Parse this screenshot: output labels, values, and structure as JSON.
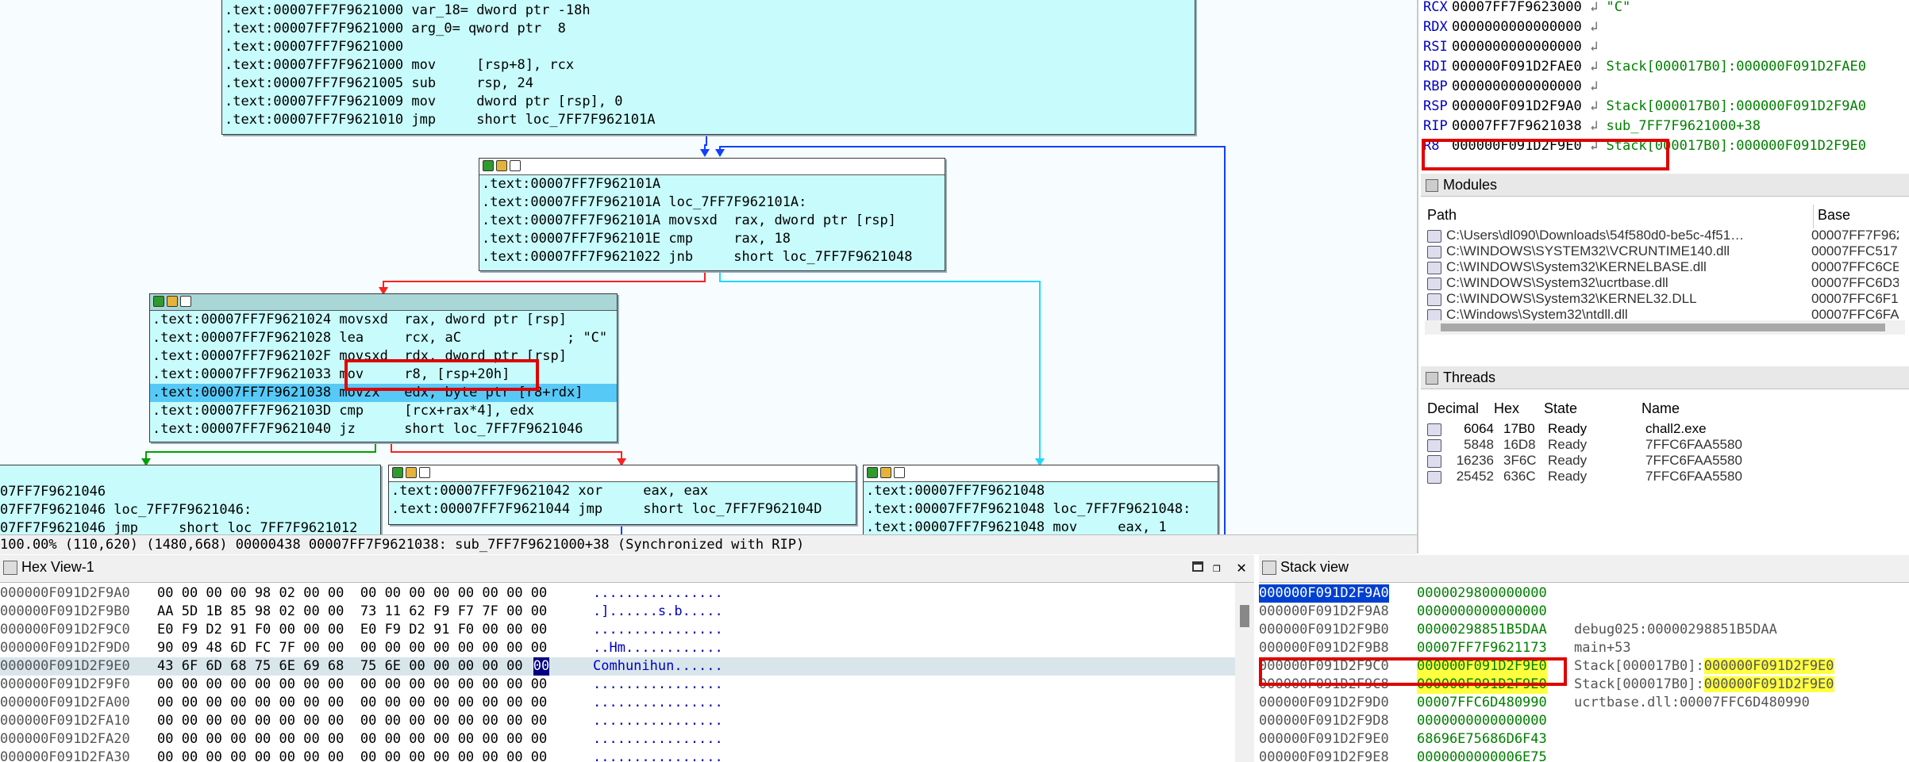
{
  "graph": {
    "top_block": [
      ".text:00007FF7F9621000 var_18= dword ptr -18h",
      ".text:00007FF7F9621000 arg_0= qword ptr  8",
      ".text:00007FF7F9621000",
      ".text:00007FF7F9621000 mov     [rsp+8], rcx",
      ".text:00007FF7F9621005 sub     rsp, 24",
      ".text:00007FF7F9621009 mov     dword ptr [rsp], 0",
      ".text:00007FF7F9621010 jmp     short loc_7FF7F962101A"
    ],
    "loop_block": [
      ".text:00007FF7F962101A",
      ".text:00007FF7F962101A loc_7FF7F962101A:",
      ".text:00007FF7F962101A movsxd  rax, dword ptr [rsp]",
      ".text:00007FF7F962101E cmp     rax, 18",
      ".text:00007FF7F9621022 jnb     short loc_7FF7F9621048"
    ],
    "body_block": [
      ".text:00007FF7F9621024 movsxd  rax, dword ptr [rsp]",
      ".text:00007FF7F9621028 lea     rcx, aC             ; \"C\"",
      ".text:00007FF7F962102F movsxd  rdx, dword ptr [rsp]",
      ".text:00007FF7F9621033 mov     r8, [rsp+20h]",
      ".text:00007FF7F9621038 movzx   edx, byte ptr [r8+rdx]",
      ".text:00007FF7F962103D cmp     [rcx+rax*4], edx",
      ".text:00007FF7F9621040 jz      short loc_7FF7F9621046"
    ],
    "left_block": [
      "07FF7F9621046",
      "07FF7F9621046 loc_7FF7F9621046:",
      "07FF7F9621046 jmp     short loc_7FF7F9621012"
    ],
    "mid_block": [
      ".text:00007FF7F9621042 xor     eax, eax",
      ".text:00007FF7F9621044 jmp     short loc_7FF7F962104D"
    ],
    "right_block": [
      ".text:00007FF7F9621048",
      ".text:00007FF7F9621048 loc_7FF7F9621048:",
      ".text:00007FF7F9621048 mov     eax, 1"
    ]
  },
  "status_bar": "100.00% (110,620) (1480,668) 00000438 00007FF7F9621038: sub_7FF7F9621000+38 (Synchronized with RIP)",
  "registers": [
    {
      "name": "RCX",
      "value": "00007FF7F9623000",
      "comment": "\"C\""
    },
    {
      "name": "RDX",
      "value": "0000000000000000",
      "comment": ""
    },
    {
      "name": "RSI",
      "value": "0000000000000000",
      "comment": ""
    },
    {
      "name": "RDI",
      "value": "000000F091D2FAE0",
      "comment": "Stack[000017B0]:000000F091D2FAE0"
    },
    {
      "name": "RBP",
      "value": "0000000000000000",
      "comment": ""
    },
    {
      "name": "RSP",
      "value": "000000F091D2F9A0",
      "comment": "Stack[000017B0]:000000F091D2F9A0"
    },
    {
      "name": "RIP",
      "value": "00007FF7F9621038",
      "comment": "sub_7FF7F9621000+38"
    },
    {
      "name": "R8",
      "value": "000000F091D2F9E0",
      "comment": "Stack[000017B0]:000000F091D2F9E0"
    }
  ],
  "modules": {
    "title": "Modules",
    "columns": [
      "Path",
      "Base"
    ],
    "rows": [
      {
        "path": "C:\\Users\\dl090\\Downloads\\54f580d0-be5c-4f51…",
        "base": "00007FF7F962"
      },
      {
        "path": "C:\\WINDOWS\\SYSTEM32\\VCRUNTIME140.dll",
        "base": "00007FFC517"
      },
      {
        "path": "C:\\WINDOWS\\System32\\KERNELBASE.dll",
        "base": "00007FFC6CE"
      },
      {
        "path": "C:\\WINDOWS\\System32\\ucrtbase.dll",
        "base": "00007FFC6D3"
      },
      {
        "path": "C:\\WINDOWS\\System32\\KERNEL32.DLL",
        "base": "00007FFC6F1"
      },
      {
        "path": "C:\\Windows\\System32\\ntdll.dll",
        "base": "00007FFC6FA"
      }
    ]
  },
  "threads": {
    "title": "Threads",
    "columns": [
      "Decimal",
      "Hex",
      "State",
      "Name"
    ],
    "rows": [
      {
        "dec": "6064",
        "hex": "17B0",
        "state": "Ready",
        "name": "chall2.exe"
      },
      {
        "dec": "5848",
        "hex": "16D8",
        "state": "Ready",
        "name": "7FFC6FAA5580"
      },
      {
        "dec": "16236",
        "hex": "3F6C",
        "state": "Ready",
        "name": "7FFC6FAA5580"
      },
      {
        "dec": "25452",
        "hex": "636C",
        "state": "Ready",
        "name": "7FFC6FAA5580"
      }
    ]
  },
  "hex_view": {
    "title": "Hex View-1",
    "rows": [
      {
        "addr": "000000F091D2F9A0",
        "bytes": "00 00 00 00 98 02 00 00  00 00 00 00 00 00 00 00",
        "ascii": "................"
      },
      {
        "addr": "000000F091D2F9B0",
        "bytes": "AA 5D 1B 85 98 02 00 00  73 11 62 F9 F7 7F 00 00",
        "ascii": ".]......s.b....."
      },
      {
        "addr": "000000F091D2F9C0",
        "bytes": "E0 F9 D2 91 F0 00 00 00  E0 F9 D2 91 F0 00 00 00",
        "ascii": "................"
      },
      {
        "addr": "000000F091D2F9D0",
        "bytes": "90 09 48 6D FC 7F 00 00  00 00 00 00 00 00 00 00",
        "ascii": "..Hm............"
      },
      {
        "addr": "000000F091D2F9E0",
        "bytes": "43 6F 6D 68 75 6E 69 68  75 6E 00 00 00 00 00 00",
        "ascii": "Comhunihun......"
      },
      {
        "addr": "000000F091D2F9F0",
        "bytes": "00 00 00 00 00 00 00 00  00 00 00 00 00 00 00 00",
        "ascii": "................"
      },
      {
        "addr": "000000F091D2FA00",
        "bytes": "00 00 00 00 00 00 00 00  00 00 00 00 00 00 00 00",
        "ascii": "................"
      },
      {
        "addr": "000000F091D2FA10",
        "bytes": "00 00 00 00 00 00 00 00  00 00 00 00 00 00 00 00",
        "ascii": "................"
      },
      {
        "addr": "000000F091D2FA20",
        "bytes": "00 00 00 00 00 00 00 00  00 00 00 00 00 00 00 00",
        "ascii": "................"
      },
      {
        "addr": "000000F091D2FA30",
        "bytes": "00 00 00 00 00 00 00 00  00 00 00 00 00 00 00 00",
        "ascii": "................"
      }
    ]
  },
  "stack_view": {
    "title": "Stack view",
    "rows": [
      {
        "addr": "000000F091D2F9A0",
        "value": "0000029800000000",
        "comment": ""
      },
      {
        "addr": "000000F091D2F9A8",
        "value": "0000000000000000",
        "comment": ""
      },
      {
        "addr": "000000F091D2F9B0",
        "value": "00000298851B5DAA",
        "comment": "debug025:00000298851B5DAA"
      },
      {
        "addr": "000000F091D2F9B8",
        "value": "00007FF7F9621173",
        "comment": "main+53"
      },
      {
        "addr": "000000F091D2F9C0",
        "value": "000000F091D2F9E0",
        "comment": "Stack[000017B0]:000000F091D2F9E0"
      },
      {
        "addr": "000000F091D2F9C8",
        "value": "000000F091D2F9E0",
        "comment": "Stack[000017B0]:000000F091D2F9E0"
      },
      {
        "addr": "000000F091D2F9D0",
        "value": "00007FFC6D480990",
        "comment": "ucrtbase.dll:00007FFC6D480990"
      },
      {
        "addr": "000000F091D2F9D8",
        "value": "0000000000000000",
        "comment": ""
      },
      {
        "addr": "000000F091D2F9E0",
        "value": "68696E75686D6F43",
        "comment": ""
      },
      {
        "addr": "000000F091D2F9E8",
        "value": "0000000000006E75",
        "comment": ""
      }
    ]
  }
}
